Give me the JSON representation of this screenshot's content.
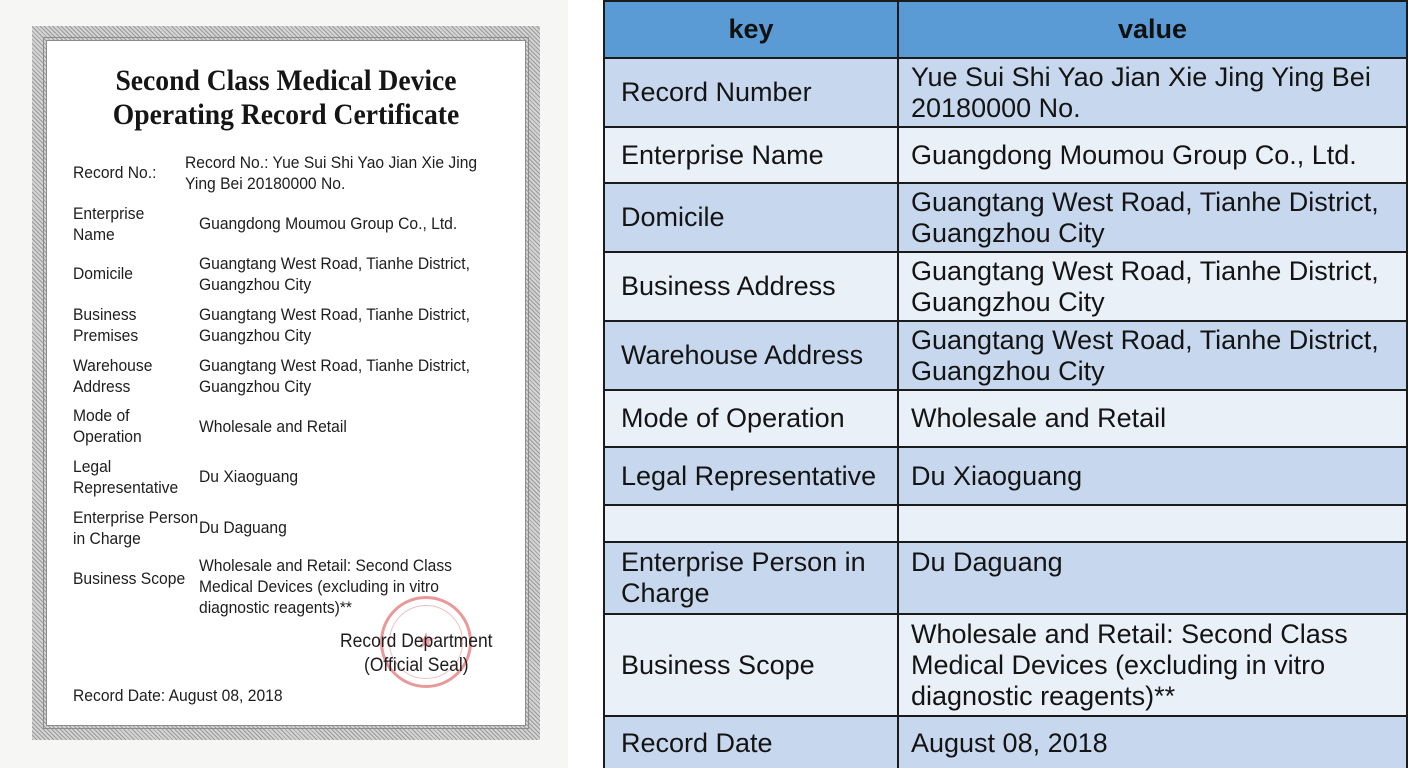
{
  "certificate": {
    "title_line1": "Second Class Medical Device",
    "title_line2": "Operating Record Certificate",
    "fields": [
      {
        "label": [
          "Record No.:"
        ],
        "value": [
          "Record No.: Yue Sui Shi Yao Jian Xie Jing",
          "Ying Bei 20180000 No."
        ]
      },
      {
        "label": [
          "Enterprise",
          "Name"
        ],
        "value": [
          "Guangdong Moumou Group Co., Ltd."
        ]
      },
      {
        "label": [
          "Domicile"
        ],
        "value": [
          "Guangtang West Road, Tianhe District,",
          "Guangzhou City"
        ]
      },
      {
        "label": [
          "Business",
          "Premises"
        ],
        "value": [
          "Guangtang West Road, Tianhe District,",
          "Guangzhou City"
        ]
      },
      {
        "label": [
          "Warehouse",
          "Address"
        ],
        "value": [
          "Guangtang West Road, Tianhe District,",
          "Guangzhou City"
        ]
      },
      {
        "label": [
          "Mode of",
          "Operation"
        ],
        "value": [
          "Wholesale and Retail"
        ]
      },
      {
        "label": [
          "Legal",
          "Representative"
        ],
        "value": [
          "Du Xiaoguang"
        ]
      },
      {
        "label": [
          "Enterprise Person",
          "in Charge"
        ],
        "value": [
          "Du Daguang"
        ]
      },
      {
        "label": [
          "Business Scope"
        ],
        "value": [
          "Wholesale and Retail: Second Class",
          "Medical Devices (excluding in vitro",
          "diagnostic reagents)**"
        ]
      }
    ],
    "department_line1": "Record Department",
    "department_line2": "(Official Seal)",
    "record_date": "Record Date: August 08, 2018",
    "seal_icon": "official-seal-stamp"
  },
  "table": {
    "header": {
      "key": "key",
      "value": "value"
    },
    "rows": [
      {
        "key": "Record Number",
        "value": "Yue Sui Shi Yao Jian Xie Jing Ying Bei 20180000 No."
      },
      {
        "key": "Enterprise Name",
        "value": "Guangdong Moumou Group Co., Ltd."
      },
      {
        "key": "Domicile",
        "value": "Guangtang West Road, Tianhe District, Guangzhou City"
      },
      {
        "key": "Business Address",
        "value": "Guangtang West Road, Tianhe District, Guangzhou City"
      },
      {
        "key": "Warehouse Address",
        "value": "Guangtang West Road, Tianhe District, Guangzhou City"
      },
      {
        "key": "Mode of Operation",
        "value": "Wholesale and Retail"
      },
      {
        "key": "Legal Representative",
        "value": "Du Xiaoguang"
      },
      {
        "key": "",
        "value": ""
      },
      {
        "key": "Enterprise Person in Charge",
        "value": "Du Daguang"
      },
      {
        "key": "Business Scope",
        "value": "Wholesale and Retail: Second Class Medical Devices (excluding in vitro diagnostic reagents)**"
      },
      {
        "key": "Record Date",
        "value": "August 08, 2018"
      }
    ],
    "colors": {
      "header": "#5b9bd5",
      "row_blue": "#c7d8ee",
      "row_light": "#eaf0f8",
      "border": "#1b1b1b"
    }
  }
}
